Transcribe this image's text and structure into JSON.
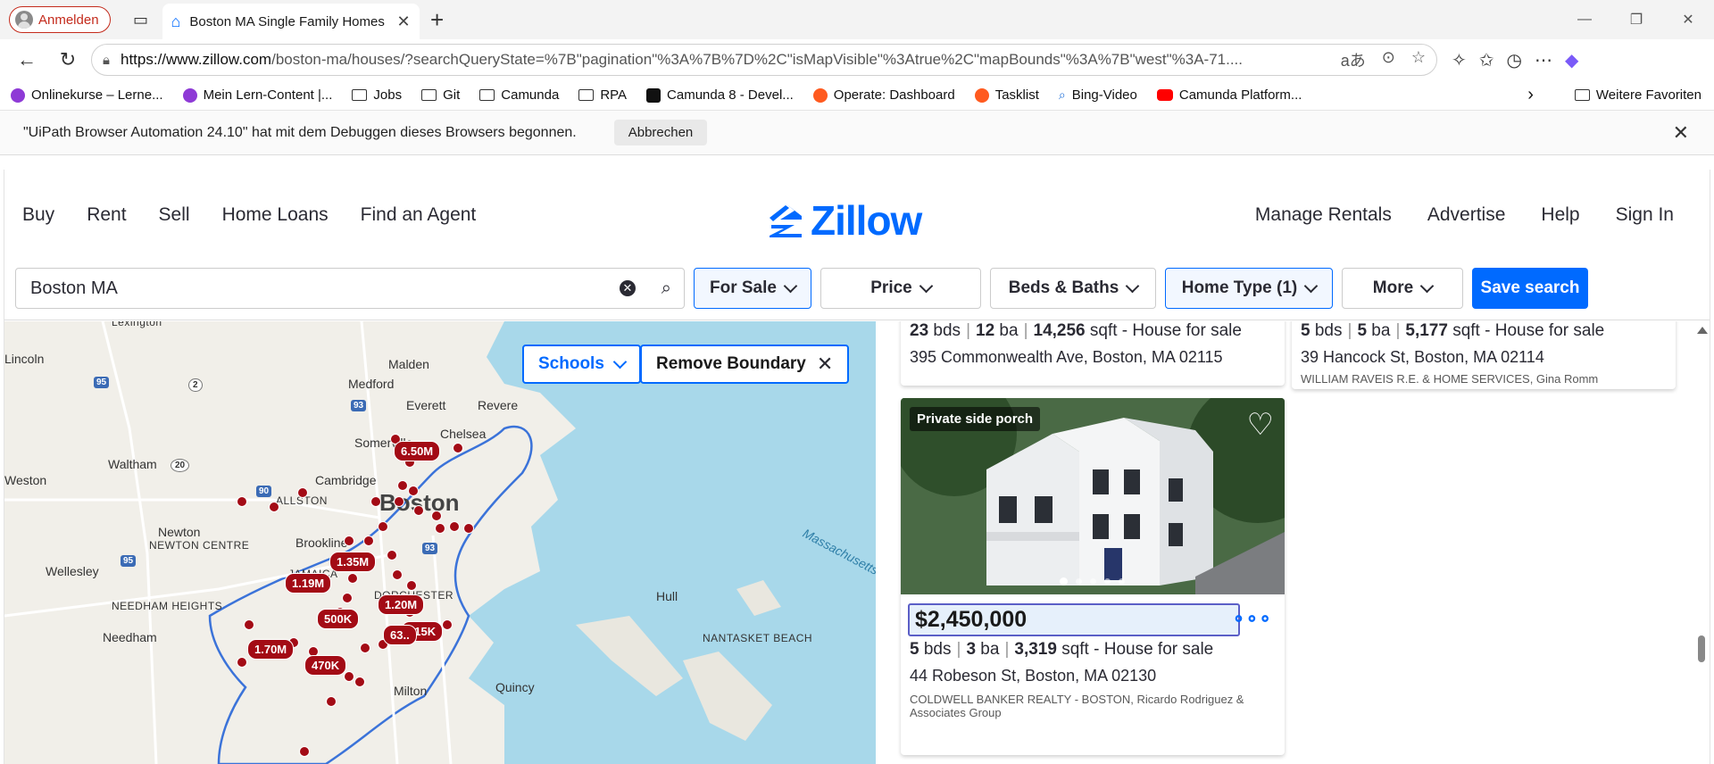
{
  "browser": {
    "profile_label": "Anmelden",
    "tab_title": "Boston MA Single Family Homes",
    "url_host": "https://www.zillow.com",
    "url_path": "/boston-ma/houses/?searchQueryState=%7B\"pagination\"%3A%7B%7D%2C\"isMapVisible\"%3Atrue%2C\"mapBounds\"%3A%7B\"west\"%3A-71....",
    "read_aloud_label": "aあ"
  },
  "favorites": [
    {
      "label": "Onlinekurse – Lerne...",
      "icon": "purple"
    },
    {
      "label": "Mein Lern-Content |...",
      "icon": "purple"
    },
    {
      "label": "Jobs",
      "icon": "folder"
    },
    {
      "label": "Git",
      "icon": "folder"
    },
    {
      "label": "Camunda",
      "icon": "folder"
    },
    {
      "label": "RPA",
      "icon": "folder"
    },
    {
      "label": "Camunda 8 - Devel...",
      "icon": "black"
    },
    {
      "label": "Operate: Dashboard",
      "icon": "orange"
    },
    {
      "label": "Tasklist",
      "icon": "orange"
    },
    {
      "label": "Bing-Video",
      "icon": "search"
    },
    {
      "label": "Camunda Platform...",
      "icon": "yt"
    }
  ],
  "favorites_more": "Weitere Favoriten",
  "infobar": {
    "message": "\"UiPath Browser Automation 24.10\" hat mit dem Debuggen dieses Browsers begonnen.",
    "cancel_label": "Abbrechen"
  },
  "zillow": {
    "logo_text": "Zillow",
    "nav_left": [
      "Buy",
      "Rent",
      "Sell",
      "Home Loans",
      "Find an Agent"
    ],
    "nav_right": [
      "Manage Rentals",
      "Advertise",
      "Help",
      "Sign In"
    ],
    "search_value": "Boston MA",
    "filters": {
      "for_sale": "For Sale",
      "price": "Price",
      "beds_baths": "Beds & Baths",
      "home_type": "Home Type (1)",
      "more": "More",
      "save_search": "Save search"
    }
  },
  "map": {
    "schools_label": "Schools",
    "remove_boundary_label": "Remove Boundary",
    "places": [
      "Lexington",
      "Lincoln",
      "Malden",
      "Medford",
      "Everett",
      "Revere",
      "Chelsea",
      "Somerville",
      "Waltham",
      "Cambridge",
      "ALLSTON",
      "Boston",
      "Weston",
      "Newton",
      "NEWTON CENTRE",
      "Brookline",
      "Wellesley",
      "JAMAICA",
      "DORCHESTER",
      "NEEDHAM HEIGHTS",
      "Needham",
      "Hull",
      "NANTASKET BEACH",
      "Quincy",
      "Milton",
      "Massachusetts"
    ],
    "price_tags": [
      "6.50M",
      "1.35M",
      "1.19M",
      "1.20M",
      "500K",
      "715K",
      "1.70M",
      "470K",
      "63.."
    ]
  },
  "listings": [
    {
      "beds": "23",
      "baths": "12",
      "sqft": "14,256",
      "type": "House for sale",
      "address": "395 Commonwealth Ave, Boston, MA 02115"
    },
    {
      "beds": "5",
      "baths": "5",
      "sqft": "5,177",
      "type": "House for sale",
      "address": "39 Hancock St, Boston, MA 02114",
      "agent": "WILLIAM RAVEIS R.E. & HOME SERVICES, Gina Romm"
    },
    {
      "badge": "Private side porch",
      "price": "$2,450,000",
      "beds": "5",
      "baths": "3",
      "sqft": "3,319",
      "type": "House for sale",
      "address": "44 Robeson St, Boston, MA 02130",
      "agent": "COLDWELL BANKER REALTY - BOSTON, Ricardo Rodriguez & Associates Group"
    }
  ],
  "units": {
    "bds": "bds",
    "ba": "ba",
    "sqft": "sqft"
  },
  "colors": {
    "zillow_blue": "#006aff",
    "pin_red": "#a30b15",
    "profile_red": "#c42b1c"
  }
}
